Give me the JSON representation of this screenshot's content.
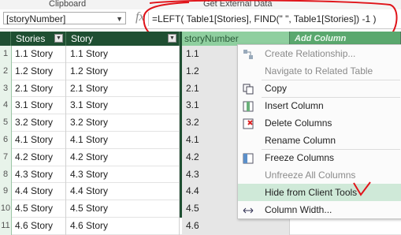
{
  "ribbon": {
    "group1": "Clipboard",
    "group2": "Get External Data"
  },
  "formula_bar": {
    "namebox_value": "[storyNumber]",
    "fx_label": "fx",
    "formula": "=LEFT( Table1[Stories], FIND(\" \", Table1[Stories]) -1 )"
  },
  "table": {
    "columns": [
      "Stories",
      "Story",
      "storyNumber",
      "Add Column"
    ],
    "rows": [
      {
        "n": "1",
        "stories": "1.1 Story",
        "story": "1.1 Story",
        "num": "1.1"
      },
      {
        "n": "2",
        "stories": "1.2 Story",
        "story": "1.2 Story",
        "num": "1.2"
      },
      {
        "n": "3",
        "stories": "2.1 Story",
        "story": "2.1 Story",
        "num": "2.1"
      },
      {
        "n": "4",
        "stories": "3.1 Story",
        "story": "3.1 Story",
        "num": "3.1"
      },
      {
        "n": "5",
        "stories": "3.2 Story",
        "story": "3.2 Story",
        "num": "3.2"
      },
      {
        "n": "6",
        "stories": "4.1 Story",
        "story": "4.1 Story",
        "num": "4.1"
      },
      {
        "n": "7",
        "stories": "4.2 Story",
        "story": "4.2 Story",
        "num": "4.2"
      },
      {
        "n": "8",
        "stories": "4.3 Story",
        "story": "4.3 Story",
        "num": "4.3"
      },
      {
        "n": "9",
        "stories": "4.4 Story",
        "story": "4.4 Story",
        "num": "4.4"
      },
      {
        "n": "10",
        "stories": "4.5 Story",
        "story": "4.5 Story",
        "num": "4.5"
      },
      {
        "n": "11",
        "stories": "4.6 Story",
        "story": "4.6 Story",
        "num": "4.6"
      }
    ]
  },
  "context_menu": {
    "items": [
      {
        "label": "Create Relationship...",
        "enabled": false,
        "icon": "relationship-icon"
      },
      {
        "label": "Navigate to Related Table",
        "enabled": false,
        "icon": ""
      },
      {
        "label": "Copy",
        "enabled": true,
        "icon": "copy-icon"
      },
      {
        "label": "Insert Column",
        "enabled": true,
        "icon": "insert-column-icon"
      },
      {
        "label": "Delete Columns",
        "enabled": true,
        "icon": "delete-column-icon"
      },
      {
        "label": "Rename Column",
        "enabled": true,
        "icon": ""
      },
      {
        "label": "Freeze Columns",
        "enabled": true,
        "icon": "freeze-icon"
      },
      {
        "label": "Unfreeze All Columns",
        "enabled": false,
        "icon": ""
      },
      {
        "label": "Hide from Client Tools",
        "enabled": true,
        "icon": "",
        "highlighted": true
      },
      {
        "label": "Column Width...",
        "enabled": true,
        "icon": "column-width-icon"
      }
    ]
  },
  "colors": {
    "header": "#1f4f32",
    "highlight": "#cfe9d8",
    "annotation": "#e0141a"
  }
}
